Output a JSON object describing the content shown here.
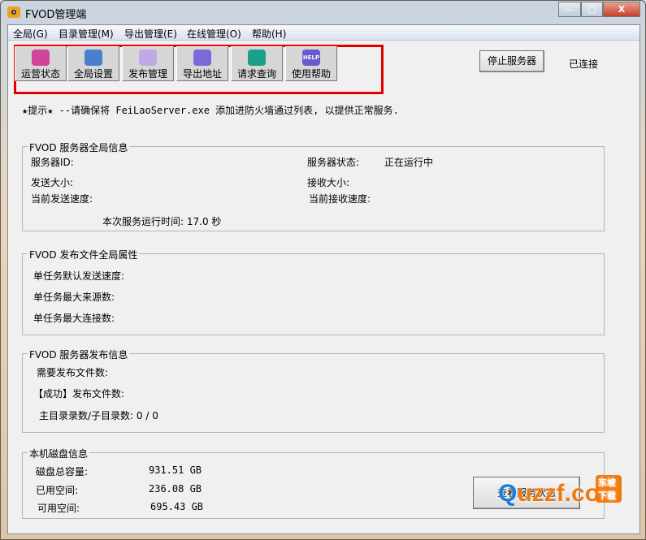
{
  "window": {
    "title": "FVOD管理端",
    "minimize": "—",
    "maximize": "□",
    "close": "X"
  },
  "menu": [
    "全局(G)",
    "目录管理(M)",
    "导出管理(E)",
    "在线管理(O)",
    "帮助(H)"
  ],
  "toolbar": [
    {
      "label": "运营状态",
      "icon": "monitor-icon",
      "color": "#d0449a"
    },
    {
      "label": "全局设置",
      "icon": "tools-icon",
      "color": "#4a7fd0"
    },
    {
      "label": "发布管理",
      "icon": "clipboard-icon",
      "color": "#c3a8e8"
    },
    {
      "label": "导出地址",
      "icon": "export-icon",
      "color": "#7a6ad8"
    },
    {
      "label": "请求查询",
      "icon": "id-card-icon",
      "color": "#1aa08a"
    },
    {
      "label": "使用帮助",
      "icon": "help-icon",
      "icon_text": "HELP",
      "color": "#6a5ad0"
    }
  ],
  "stop_button": "停止服务器",
  "connection_status": "已连接",
  "tip": "★提示★ --请确保将 FeiLaoServer.exe  添加进防火墙通过列表, 以提供正常服务.",
  "server_info": {
    "title": "FVOD 服务器全局信息",
    "server_id": "服务器ID:",
    "server_status_label": "服务器状态:",
    "server_status": "正在运行中",
    "send_size": "发送大小:",
    "recv_size": "接收大小:",
    "send_speed": "当前发送速度:",
    "recv_speed": "当前接收速度:",
    "uptime": "本次服务运行时间: 17.0 秒"
  },
  "publish_props": {
    "title": "FVOD 发布文件全局属性",
    "default_speed": "单任务默认发送速度:",
    "max_sources": "单任务最大来源数:",
    "max_connections": "单任务最大连接数:"
  },
  "publish_info": {
    "title": "FVOD 服务器发布信息",
    "need_files": "需要发布文件数:",
    "success_files": "【成功】发布文件数:",
    "dirs": "主目录录数/子目录数:  0 / 0"
  },
  "disk": {
    "title": "本机磁盘信息",
    "total_label": "磁盘总容量:",
    "total": "931.51 GB",
    "used_label": "已用空间:",
    "used": "236.08 GB",
    "free_label": "可用空间:",
    "free": "695.43 GB"
  },
  "view_status_button": "查看服务状态",
  "watermark": {
    "text": "uzzf.com",
    "badge": "东坡下载"
  }
}
